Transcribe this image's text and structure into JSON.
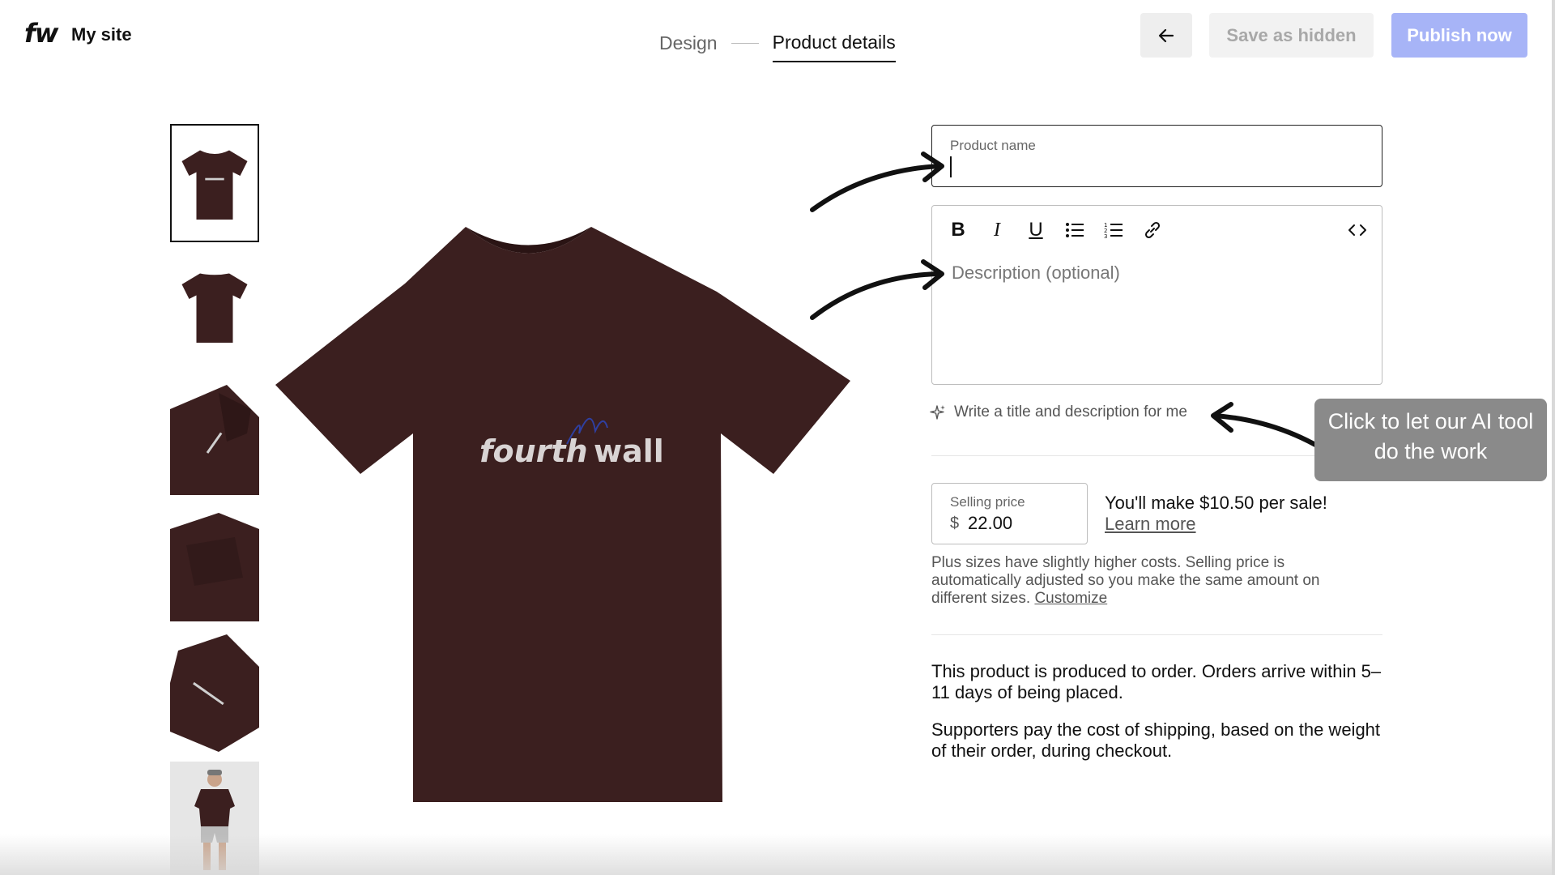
{
  "header": {
    "logo": "fw",
    "site_name": "My site",
    "steps": [
      "Design",
      "Product details"
    ],
    "active_step": "Product details",
    "back_icon": "arrow-left-icon",
    "save_hidden_label": "Save as hidden",
    "publish_label": "Publish now"
  },
  "product": {
    "brand_text_1": "fourth",
    "brand_text_2": "wall",
    "shirt_color": "#3b1f1f",
    "thumbnails": [
      "front",
      "back",
      "sleeve",
      "side-fold",
      "folded",
      "model"
    ]
  },
  "form": {
    "name_label": "Product name",
    "name_value": "",
    "description_placeholder": "Description (optional)",
    "toolbar": [
      "bold-icon",
      "italic-icon",
      "underline-icon",
      "bullet-list-icon",
      "numbered-list-icon",
      "link-icon",
      "code-icon"
    ],
    "ai_prompt": "Write a title and description for me",
    "price_label": "Selling price",
    "currency": "$",
    "price_value": "22.00",
    "profit_text": "You'll make $10.50 per sale!",
    "learn_more": "Learn more",
    "plus_note": "Plus sizes have slightly higher costs. Selling price is automatically adjusted so you make the same amount on different sizes.",
    "customize": "Customize",
    "info_1": "This product is produced to order. Orders arrive within 5–11 days of being placed.",
    "info_2": "Supporters pay the cost of shipping, based on the weight of their order, during checkout."
  },
  "annotation": {
    "tooltip": "Click to let our AI tool do the work"
  },
  "colors": {
    "publish": "#a7b4f7",
    "shirt": "#3b1f1f"
  }
}
